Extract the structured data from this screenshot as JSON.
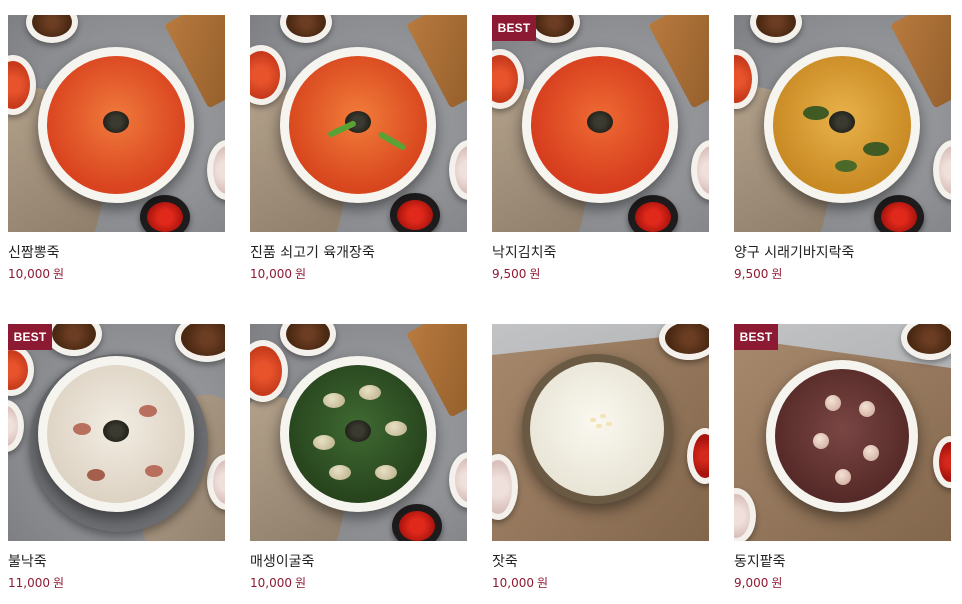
{
  "products": [
    {
      "name": "신짬뽕죽",
      "price": "10,000",
      "currency": "원",
      "badge": "",
      "porridge": "#e2542a",
      "style": "seafood"
    },
    {
      "name": "진품 쇠고기 육개장죽",
      "price": "10,000",
      "currency": "원",
      "badge": "",
      "porridge": "#e4582c",
      "style": "beef"
    },
    {
      "name": "낙지김치죽",
      "price": "9,500",
      "currency": "원",
      "badge": "BEST",
      "porridge": "#e24f28",
      "style": "octopus"
    },
    {
      "name": "양구 시래기바지락죽",
      "price": "9,500",
      "currency": "원",
      "badge": "",
      "porridge": "#d79a32",
      "style": "clam"
    },
    {
      "name": "불낙죽",
      "price": "11,000",
      "currency": "원",
      "badge": "BEST",
      "porridge": "#ece6da",
      "style": "bulnak"
    },
    {
      "name": "매생이굴죽",
      "price": "10,000",
      "currency": "원",
      "badge": "",
      "porridge": "#33582a",
      "style": "seaweed"
    },
    {
      "name": "잣죽",
      "price": "10,000",
      "currency": "원",
      "badge": "",
      "porridge": "#f1eee2",
      "style": "pinenut"
    },
    {
      "name": "동지팥죽",
      "price": "9,000",
      "currency": "원",
      "badge": "BEST",
      "porridge": "#6b3c3a",
      "style": "redbean"
    }
  ],
  "colors": {
    "accent": "#8d1a33",
    "name_text": "#222222",
    "badge_text": "#ffffff"
  }
}
